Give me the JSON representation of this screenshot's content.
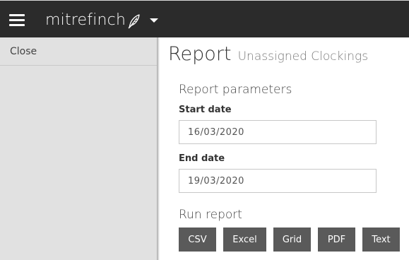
{
  "header": {
    "brand_name": "mitrefinch",
    "icons": {
      "menu": "hamburger-menu-icon",
      "brand_mark": "feather-pen-icon",
      "dropdown": "caret-down-icon"
    }
  },
  "sidebar": {
    "close_label": "Close"
  },
  "page": {
    "title": "Report",
    "subtitle": "Unassigned Clockings"
  },
  "parameters": {
    "heading": "Report parameters",
    "start_date_label": "Start date",
    "start_date_value": "16/03/2020",
    "end_date_label": "End date",
    "end_date_value": "19/03/2020"
  },
  "run": {
    "heading": "Run report",
    "buttons": {
      "csv": "CSV",
      "excel": "Excel",
      "grid": "Grid",
      "pdf": "PDF",
      "text": "Text"
    }
  },
  "colors": {
    "topbar": "#2b2b2b",
    "sidebar": "#e1e1e1",
    "button": "#5a5a5a"
  }
}
